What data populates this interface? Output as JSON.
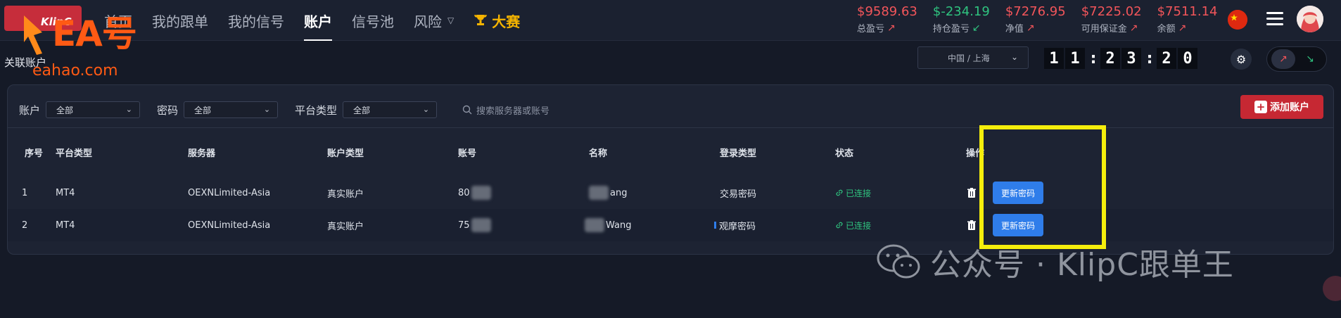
{
  "brand": {
    "logo_text": "KlipC"
  },
  "nav": {
    "items": [
      {
        "label": "首页"
      },
      {
        "label": "我的跟单"
      },
      {
        "label": "我的信号"
      },
      {
        "label": "账户",
        "active": true
      },
      {
        "label": "信号池"
      },
      {
        "label": "风险"
      }
    ],
    "contest_label": "大赛"
  },
  "stats": [
    {
      "value": "$9589.63",
      "label": "总盈亏",
      "trend": "up",
      "color": "#f2555a"
    },
    {
      "value": "$-234.19",
      "label": "持仓盈亏",
      "trend": "down",
      "color": "#2fc37f"
    },
    {
      "value": "$7276.95",
      "label": "净值",
      "trend": "up",
      "color": "#f2555a"
    },
    {
      "value": "$7225.02",
      "label": "可用保证金",
      "trend": "up",
      "color": "#f2555a"
    },
    {
      "value": "$7511.14",
      "label": "余额",
      "trend": "up",
      "color": "#f2555a"
    }
  ],
  "watermark": {
    "ea": "EA号",
    "site": "eahao.com",
    "wechat": "公众号 · KlipC跟单王"
  },
  "subbar": {
    "title": "关联账户",
    "timezone": "中国 / 上海",
    "clock": [
      "1",
      "1",
      ":",
      "2",
      "3",
      ":",
      "2",
      "0"
    ]
  },
  "filters": {
    "account_label": "账户",
    "account_value": "全部",
    "password_label": "密码",
    "password_value": "全部",
    "platform_label": "平台类型",
    "platform_value": "全部",
    "search_placeholder": "搜索服务器或账号",
    "add_button": "添加账户"
  },
  "table": {
    "headers": [
      "序号",
      "平台类型",
      "服务器",
      "账户类型",
      "账号",
      "名称",
      "登录类型",
      "状态",
      "操作"
    ],
    "rows": [
      {
        "idx": "1",
        "platform": "MT4",
        "server": "OEXNLimited-Asia",
        "acct_type": "真实账户",
        "acct_no": "80",
        "name": "ang",
        "login_type": "交易密码",
        "status": "已连接",
        "action": "更新密码"
      },
      {
        "idx": "2",
        "platform": "MT4",
        "server": "OEXNLimited-Asia",
        "acct_type": "真实账户",
        "acct_no": "75",
        "name": "Wang",
        "login_type": "观摩密码",
        "status": "已连接",
        "action": "更新密码"
      }
    ]
  },
  "colors": {
    "accent_red": "#c62833",
    "profit_red": "#f2555a",
    "loss_green": "#2fc37f",
    "highlight": "#f5ee0c",
    "primary_blue": "#2f7dea"
  }
}
